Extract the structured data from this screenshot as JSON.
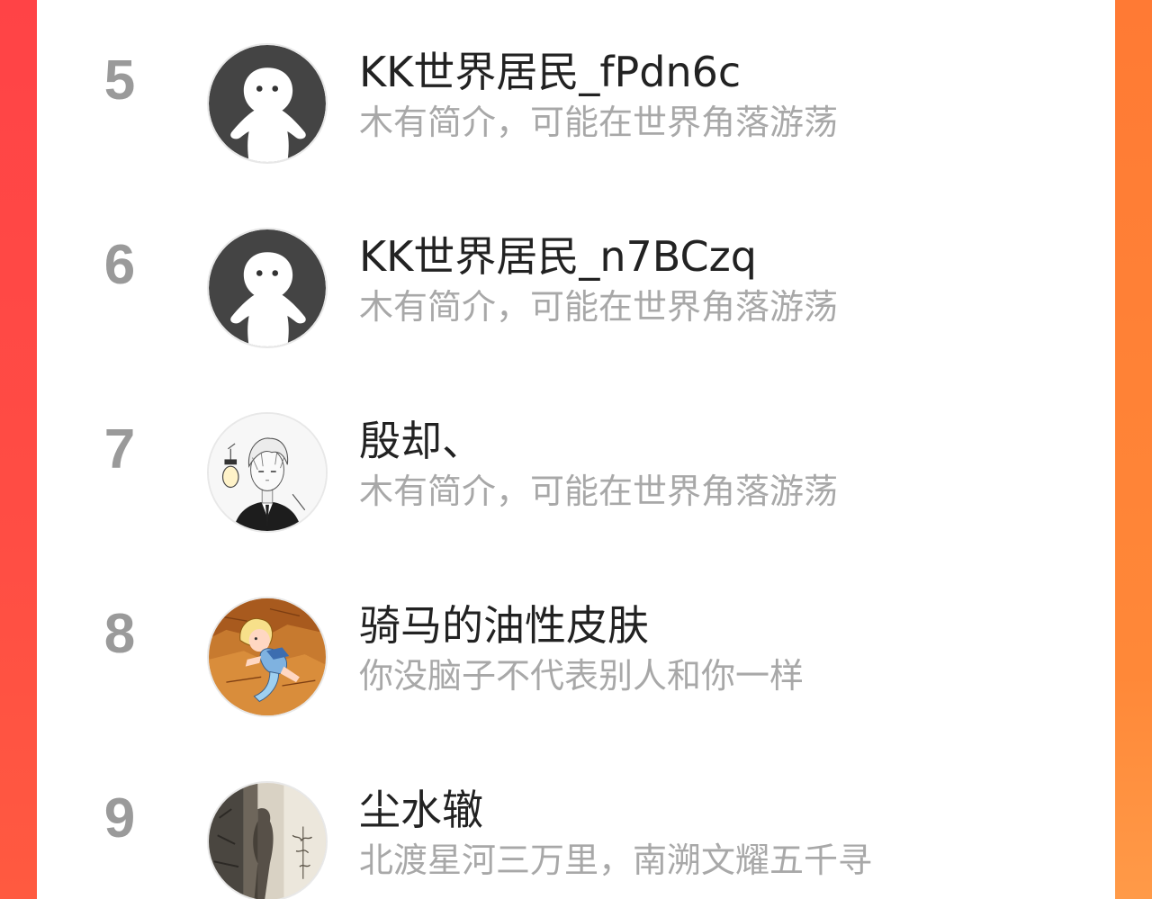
{
  "ranking": {
    "items": [
      {
        "rank": "5",
        "name": "KK世界居民_fPdn6c",
        "bio": "木有简介，可能在世界角落游荡",
        "avatar": "default-ghost-avatar"
      },
      {
        "rank": "6",
        "name": "KK世界居民_n7BCzq",
        "bio": "木有简介，可能在世界角落游荡",
        "avatar": "default-ghost-avatar"
      },
      {
        "rank": "7",
        "name": "殷却、",
        "bio": "木有简介，可能在世界角落游荡",
        "avatar": "manga-boy-avatar"
      },
      {
        "rank": "8",
        "name": "骑马的油性皮肤",
        "bio": "你没脑子不代表别人和你一样",
        "avatar": "cartoon-girl-avatar"
      },
      {
        "rank": "9",
        "name": "尘水辙",
        "bio": "北渡星河三万里，南溯文耀五千寻",
        "avatar": "shadow-photo-avatar"
      }
    ]
  },
  "colors": {
    "accent_left": "#ff4346",
    "accent_right": "#ff8838",
    "rank_text": "#9a9a9a",
    "name_text": "#222222",
    "bio_text": "#a8a8a8"
  }
}
